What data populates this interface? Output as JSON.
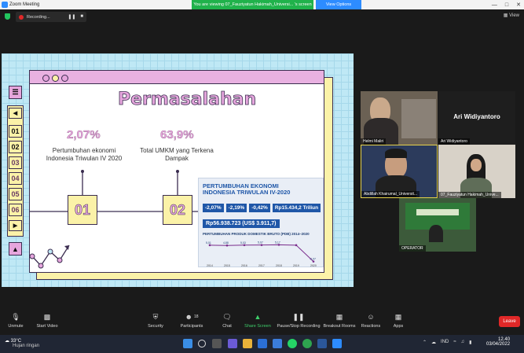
{
  "window": {
    "title": "Zoom Meeting",
    "banner": "You are viewing 07_Fauziyatun Hakimah_Universi... 's screen",
    "view_options": "View Options"
  },
  "recording": {
    "label": "Recording..."
  },
  "view_label": "View",
  "slide": {
    "title": "Permasalahan",
    "side_buttons": [
      "01",
      "02",
      "03",
      "04",
      "05",
      "06"
    ],
    "stat1": {
      "value": "2,07%",
      "label": "Pertumbuhan ekonomi Indonesia Triwulan IV 2020"
    },
    "stat2": {
      "value": "63,9%",
      "label": "Total UMKM yang Terkena Dampak"
    },
    "box1": "01",
    "box2": "02",
    "infographic": {
      "title1": "PERTUMBUHAN EKONOMI",
      "title2": "INDONESIA TRIWULAN IV-2020",
      "metrics": [
        "-2,07%",
        "-2,19%",
        "-0,42%",
        "Rp15.434,2 Triliun"
      ],
      "gdp_per_capita": "Rp56.938.723 (US$ 3.911,7)",
      "chart_title": "PERTUMBUHAN PRODUK DOMESTIK BRUTO (PDB) 2014–2020",
      "years": [
        "2014",
        "2015",
        "2016",
        "2017",
        "2018",
        "2019",
        "2020"
      ],
      "growth": [
        5.01,
        4.88,
        5.03,
        5.07,
        5.17,
        5.02,
        -2.07
      ],
      "growth_labels": [
        "5,01",
        "4,88",
        "5,03",
        "5,07",
        "5,17",
        "",
        "-2,07"
      ]
    }
  },
  "participants": [
    {
      "name": "Helmi Maliri"
    },
    {
      "name": "Ari Widiyantoro",
      "big_label": "Ari Widiyantoro"
    },
    {
      "name": "Abdillah Khairumal_Universit..."
    },
    {
      "name": "07_Fauziyatun Hakimah_Unive..."
    },
    {
      "name": "OPERATOR"
    }
  ],
  "toolbar": {
    "unmute": "Unmute",
    "start_video": "Start Video",
    "security": "Security",
    "participants": "Participants",
    "participants_count": "18",
    "chat": "Chat",
    "share_screen": "Share Screen",
    "record": "Pause/Stop Recording",
    "breakout": "Breakout Rooms",
    "reactions": "Reactions",
    "apps": "Apps",
    "leave": "Leave"
  },
  "taskbar": {
    "weather_temp": "33°C",
    "weather_desc": "Hujan ringan",
    "lang": "IND",
    "time": "12.40",
    "date": "03/04/2022"
  },
  "colors": {
    "pink": "#e6a6dd",
    "yellow": "#fbf2a8",
    "outline": "#3b2d50",
    "sky": "#bfe8f5",
    "leave": "#e02828",
    "share": "#20b24b"
  }
}
